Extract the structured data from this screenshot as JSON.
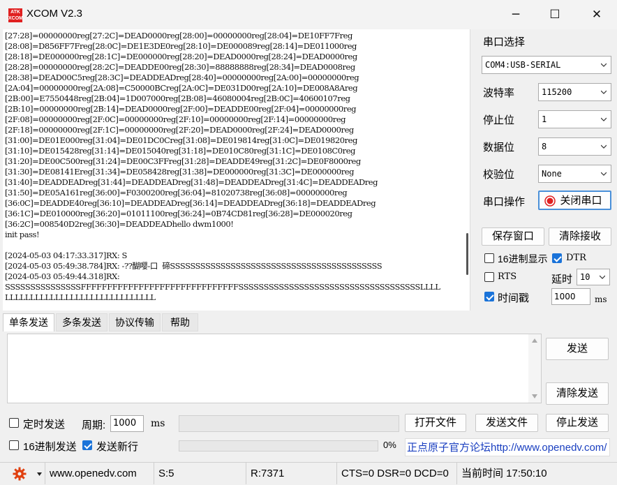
{
  "window": {
    "title": "XCOM V2.3",
    "logo_text": "ATK XCOM",
    "minimize": "─",
    "maximize": "☐",
    "close": "✕"
  },
  "receive_area": {
    "lines": [
      "[27:28]=00000000reg[27:2C]=DEAD0000reg[28:00]=00000000reg[28:04]=DE10FF7Freg",
      "[28:08]=D856FF7Freg[28:0C]=DE1E3DE0reg[28:10]=DE000089reg[28:14]=DE011000reg",
      "[28:18]=DE000000reg[28:1C]=DE000000reg[28:20]=DEAD0000reg[28:24]=DEAD0000reg",
      "[28:28]=00000000reg[28:2C]=DEADDE00reg[28:30]=88888888reg[28:34]=DEAD0008reg",
      "[28:38]=DEAD00C5reg[28:3C]=DEADDEADreg[28:40]=00000000reg[2A:00]=00000000reg",
      "[2A:04]=00000000reg[2A:08]=C50000BCreg[2A:0C]=DE031D00reg[2A:10]=DE008A8Areg",
      "[2B:00]=E7550448reg[2B:04]=1D007000reg[2B:08]=46080004reg[2B:0C]=40600107reg",
      "[2B:10]=00000000reg[2B:14]=DEAD0000reg[2F:00]=DEADDE00reg[2F:04]=00000000reg",
      "[2F:08]=00000000reg[2F:0C]=00000000reg[2F:10]=00000000reg[2F:14]=00000000reg",
      "[2F:18]=00000000reg[2F:1C]=00000000reg[2F:20]=DEAD0000reg[2F:24]=DEAD0000reg",
      "[31:00]=DE01E000reg[31:04]=DE01DC0Creg[31:08]=DE019814reg[31:0C]=DE019820reg",
      "[31:10]=DE015428reg[31:14]=DE015040reg[31:18]=DE010C80reg[31:1C]=DE0108C0reg",
      "[31:20]=DE00C500reg[31:24]=DE00C3FFreg[31:28]=DEADDE49reg[31:2C]=DE0F8000reg",
      "[31:30]=DE08141Ereg[31:34]=DE058428reg[31:38]=DE000000reg[31:3C]=DE000000reg",
      "[31:40]=DEADDEADreg[31:44]=DEADDEADreg[31:48]=DEADDEADreg[31:4C]=DEADDEADreg",
      "[31:50]=DE05A161reg[36:00]=F0300200reg[36:04]=81020738reg[36:08]=00000000reg",
      "[36:0C]=DEADDE40reg[36:10]=DEADDEADreg[36:14]=DEADDEADreg[36:18]=DEADDEADreg",
      "[36:1C]=DE010000reg[36:20]=01011100reg[36:24]=0B74CD81reg[36:28]=DE000020reg",
      "[36:2C]=008540D2reg[36:30]=DEADDEADhello dwm1000!",
      "init pass!",
      "",
      "[2024-05-03 04:17:33.317]RX: S",
      "[2024-05-03 05:49:38.784]RX: -??醐嘤-口  碲SSSSSSSSSSSSSSSSSSSSSSSSSSSSSSSSSSSSSSSSSS",
      "[2024-05-03 05:49:44.318]RX:",
      "SSSSSSSSSSSSSSSFFFFFFFFFFFFFFFFFFFFFFFFFFFFFFSSSSSSSSSSSSSSSSSSSSSSSSSSSSSSSSSSSSLLLL",
      "LLLLLLLLLLLLLLLLLLLLLLLLLLLLLL"
    ]
  },
  "right_panel": {
    "port_select_label": "串口选择",
    "port_value": "COM4:USB-SERIAL",
    "baud_label": "波特率",
    "baud_value": "115200",
    "stop_label": "停止位",
    "stop_value": "1",
    "data_label": "数据位",
    "data_value": "8",
    "parity_label": "校验位",
    "parity_value": "None",
    "op_label": "串口操作",
    "close_port_button": "关闭串口",
    "save_window_button": "保存窗口",
    "clear_receive_button": "清除接收",
    "hex_display_label": "16进制显示",
    "dtr_label": "DTR",
    "rts_label": "RTS",
    "delay_label": "延时",
    "delay_value": "10",
    "timestamp_label": "时间戳",
    "timestamp_value": "1000",
    "ms_label": "ms"
  },
  "tabs": [
    "单条发送",
    "多条发送",
    "协议传输",
    "帮助"
  ],
  "send": {
    "send_button": "发送",
    "clear_send_button": "清除发送",
    "timed_send_label": "定时发送",
    "period_label": "周期:",
    "period_value": "1000",
    "period_unit": "ms",
    "open_file_button": "打开文件",
    "send_file_button": "发送文件",
    "stop_send_button": "停止发送",
    "hex_send_label": "16进制发送",
    "newline_label": "发送新行",
    "progress_text": "0%",
    "progress_value": 0,
    "forum_link": "正点原子官方论坛http://www.openedv.com/"
  },
  "status_bar": {
    "url": "www.openedv.com",
    "sent": "S:5",
    "received": "R:7371",
    "lines": "CTS=0 DSR=0 DCD=0",
    "time": "当前时间 17:50:10"
  },
  "colors": {
    "accent": "#1a73d9",
    "close_port_icon": "#e02020",
    "link": "#1a3fc0",
    "gear": "#e04010"
  }
}
